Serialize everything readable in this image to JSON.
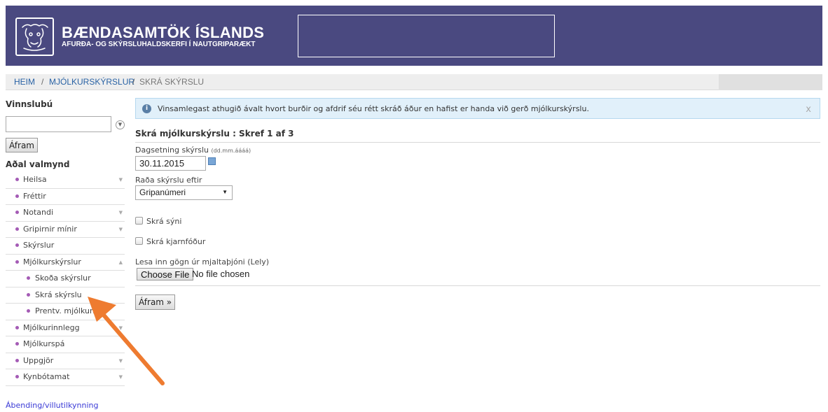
{
  "header": {
    "title": "BÆNDASAMTÖK ÍSLANDS",
    "subtitle": "AFURÐA- OG SKÝRSLUHALDSKERFI Í NAUTGRIPARÆKT",
    "colors": {
      "bar": "#4a4980",
      "accent_dot": "#a45bb5"
    }
  },
  "breadcrumb": {
    "items": [
      "HEIM",
      "MJÓLKURSKÝRSLUR",
      "SKRÁ SKÝRSLU"
    ],
    "separator": "/"
  },
  "sidebar": {
    "work_title": "Vinnslubú",
    "work_input_value": "",
    "work_button": "Áfram",
    "menu_title": "Aðal valmynd",
    "items": [
      {
        "label": "Heilsa",
        "arrow": "▼"
      },
      {
        "label": "Fréttir",
        "arrow": ""
      },
      {
        "label": "Notandi",
        "arrow": "▼"
      },
      {
        "label": "Gripirnir mínir",
        "arrow": "▼"
      },
      {
        "label": "Skýrslur",
        "arrow": ""
      },
      {
        "label": "Mjólkurskýrslur",
        "arrow": "▲"
      }
    ],
    "subitems": [
      {
        "label": "Skoða skýrslur"
      },
      {
        "label": "Skrá skýrslu"
      },
      {
        "label": "Prentv. mjólkurs"
      }
    ],
    "items_after": [
      {
        "label": "Mjólkurinnlegg",
        "arrow": "▼"
      },
      {
        "label": "Mjólkurspá",
        "arrow": ""
      },
      {
        "label": "Uppgjör",
        "arrow": "▼"
      },
      {
        "label": "Kynbótamat",
        "arrow": "▼"
      }
    ],
    "feedback_link": "Ábending/villutilkynning"
  },
  "main": {
    "info": {
      "icon": "info-icon",
      "text": "Vinsamlegast athugið ávalt hvort burðir og afdrif séu rétt skráð áður en hafist er handa við gerð mjólkurskýrslu.",
      "close": "x"
    },
    "form_title": "Skrá mjólkurskýrslu : Skref 1 af 3",
    "date_label": "Dagsetning skýrslu",
    "date_hint": "(dd.mm.áááá)",
    "date_value": "30.11.2015",
    "sort_label": "Raða skýrslu eftir",
    "sort_value": "Gripanúmeri",
    "check1_label": "Skrá sýni",
    "check2_label": "Skrá kjarnfóður",
    "file_label": "Lesa inn gögn úr mjaltaþjóni (Lely)",
    "file_button": "Choose File",
    "file_status": "No file chosen",
    "submit_label": "Áfram »"
  }
}
